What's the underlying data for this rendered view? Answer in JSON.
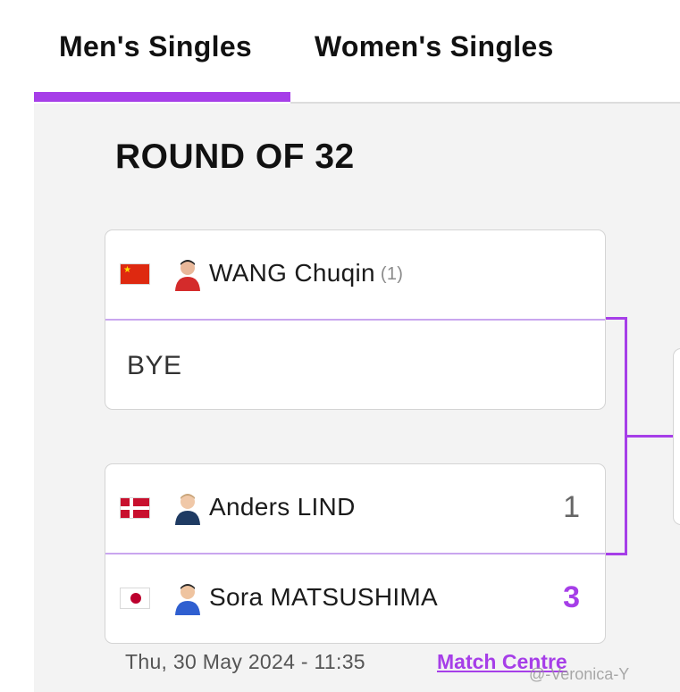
{
  "tabs": [
    {
      "label": "Men's Singles",
      "active": true
    },
    {
      "label": "Women's Singles",
      "active": false
    }
  ],
  "round_title": "ROUND OF 32",
  "matches": [
    {
      "top": {
        "name": "WANG Chuqin",
        "seed": "(1)",
        "flag": "china-flag-icon",
        "avatar": "player-avatar-icon"
      },
      "bottom": {
        "bye_label": "BYE"
      }
    },
    {
      "top": {
        "name": "Anders LIND",
        "score": "1",
        "flag": "denmark-flag-icon",
        "avatar": "player-avatar-icon"
      },
      "bottom": {
        "name": "Sora MATSUSHIMA",
        "score": "3",
        "flag": "japan-flag-icon",
        "avatar": "player-avatar-icon"
      },
      "datetime": "Thu, 30 May 2024 - 11:35",
      "link_label": "Match Centre"
    }
  ],
  "watermark": "@-Veronica-Y",
  "colors": {
    "accent": "#a63ee8",
    "background": "#f3f3f3"
  }
}
